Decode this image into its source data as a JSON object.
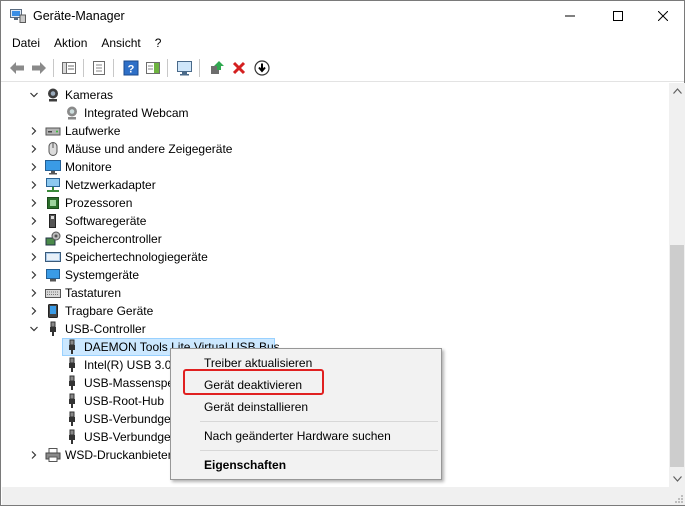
{
  "window": {
    "title": "Geräte-Manager"
  },
  "menubar": {
    "items": [
      "Datei",
      "Aktion",
      "Ansicht",
      "?"
    ]
  },
  "tree": {
    "items": [
      {
        "label": "Kameras",
        "expanded": true,
        "icon": "camera-icon"
      },
      {
        "label": "Integrated Webcam",
        "child": true,
        "icon": "webcam-icon"
      },
      {
        "label": "Laufwerke",
        "icon": "drive-icon"
      },
      {
        "label": "Mäuse und andere Zeigegeräte",
        "icon": "mouse-icon"
      },
      {
        "label": "Monitore",
        "icon": "monitor-icon"
      },
      {
        "label": "Netzwerkadapter",
        "icon": "network-icon"
      },
      {
        "label": "Prozessoren",
        "icon": "processor-icon"
      },
      {
        "label": "Softwaregeräte",
        "icon": "software-device-icon"
      },
      {
        "label": "Speichercontroller",
        "icon": "storage-controller-icon"
      },
      {
        "label": "Speichertechnologiegeräte",
        "icon": "storage-tech-icon"
      },
      {
        "label": "Systemgeräte",
        "icon": "system-device-icon"
      },
      {
        "label": "Tastaturen",
        "icon": "keyboard-icon"
      },
      {
        "label": "Tragbare Geräte",
        "icon": "portable-device-icon"
      },
      {
        "label": "USB-Controller",
        "expanded": true,
        "icon": "usb-icon"
      },
      {
        "label": "DAEMON Tools Lite Virtual USB Bus",
        "child": true,
        "selected": true,
        "icon": "usb-plug-icon"
      },
      {
        "label": "Intel(R) USB 3.0",
        "child": true,
        "icon": "usb-plug-icon"
      },
      {
        "label": "USB-Massenspe",
        "child": true,
        "icon": "usb-plug-icon"
      },
      {
        "label": "USB-Root-Hub",
        "child": true,
        "icon": "usb-plug-icon"
      },
      {
        "label": "USB-Verbundge",
        "child": true,
        "icon": "usb-plug-icon"
      },
      {
        "label": "USB-Verbundge",
        "child": true,
        "icon": "usb-plug-icon"
      },
      {
        "label": "WSD-Druckanbieter",
        "icon": "printer-icon"
      }
    ]
  },
  "context_menu": {
    "items": [
      {
        "label": "Treiber aktualisieren"
      },
      {
        "label": "Gerät deaktivieren",
        "highlighted": true
      },
      {
        "label": "Gerät deinstallieren"
      },
      {
        "label": "Nach geänderter Hardware suchen"
      },
      {
        "label": "Eigenschaften",
        "bold": true
      }
    ]
  },
  "colors": {
    "selection": "#cce8ff",
    "highlight_border": "#e02020",
    "menu_bg": "#f2f2f2"
  }
}
